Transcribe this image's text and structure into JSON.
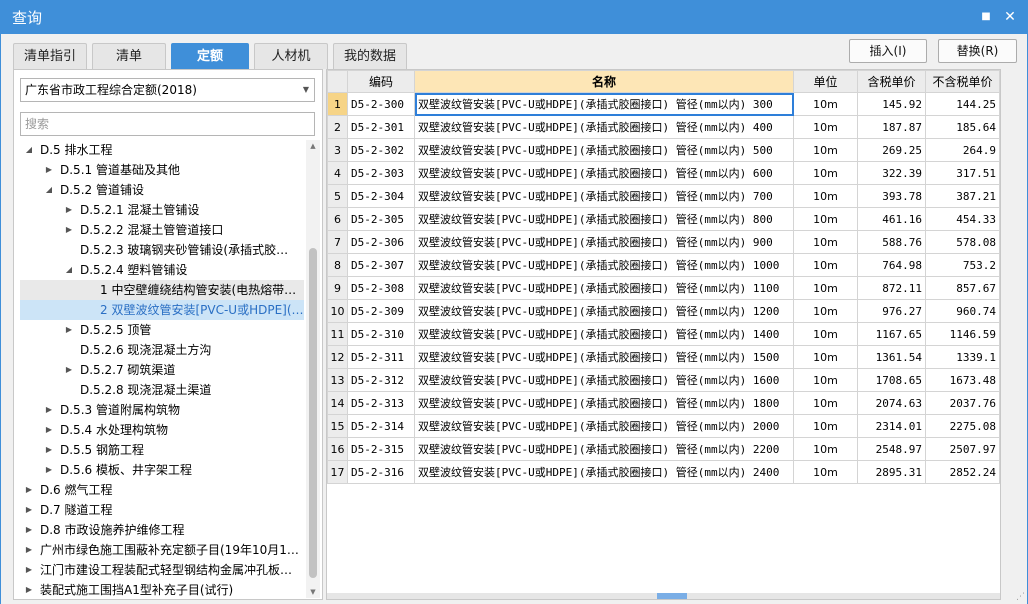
{
  "window": {
    "title": "查询",
    "maximize_icon": "■",
    "close_icon": "✕"
  },
  "tabs": [
    {
      "label": "清单指引",
      "active": false
    },
    {
      "label": "清单",
      "active": false
    },
    {
      "label": "定额",
      "active": true
    },
    {
      "label": "人材机",
      "active": false
    },
    {
      "label": "我的数据",
      "active": false
    }
  ],
  "actions": {
    "insert": "插入(I)",
    "replace": "替换(R)"
  },
  "library": {
    "selected": "广东省市政工程综合定额(2018)"
  },
  "search": {
    "placeholder": "搜索"
  },
  "tree": [
    {
      "level": 0,
      "expanded": true,
      "has_children": true,
      "label": "D.5 排水工程"
    },
    {
      "level": 1,
      "expanded": false,
      "has_children": true,
      "label": "D.5.1 管道基础及其他"
    },
    {
      "level": 1,
      "expanded": true,
      "has_children": true,
      "label": "D.5.2 管道铺设"
    },
    {
      "level": 2,
      "expanded": false,
      "has_children": true,
      "label": "D.5.2.1 混凝土管铺设"
    },
    {
      "level": 2,
      "expanded": false,
      "has_children": true,
      "label": "D.5.2.2 混凝土管管道接口"
    },
    {
      "level": 2,
      "expanded": false,
      "has_children": false,
      "label": "D.5.2.3 玻璃钢夹砂管铺设(承插式胶…"
    },
    {
      "level": 2,
      "expanded": true,
      "has_children": true,
      "label": "D.5.2.4 塑料管铺设"
    },
    {
      "level": 3,
      "expanded": false,
      "has_children": false,
      "label": "1 中空壁缠绕结构管安装(电热熔带…",
      "state": "hover"
    },
    {
      "level": 3,
      "expanded": false,
      "has_children": false,
      "label": "2 双壁波纹管安装[PVC-U或HDPE](…",
      "state": "selected"
    },
    {
      "level": 2,
      "expanded": false,
      "has_children": true,
      "label": "D.5.2.5 顶管"
    },
    {
      "level": 2,
      "expanded": false,
      "has_children": false,
      "label": "D.5.2.6 现浇混凝土方沟"
    },
    {
      "level": 2,
      "expanded": false,
      "has_children": true,
      "label": "D.5.2.7 砌筑渠道"
    },
    {
      "level": 2,
      "expanded": false,
      "has_children": false,
      "label": "D.5.2.8 现浇混凝土渠道"
    },
    {
      "level": 1,
      "expanded": false,
      "has_children": true,
      "label": "D.5.3 管道附属构筑物"
    },
    {
      "level": 1,
      "expanded": false,
      "has_children": true,
      "label": "D.5.4 水处理构筑物"
    },
    {
      "level": 1,
      "expanded": false,
      "has_children": true,
      "label": "D.5.5 钢筋工程"
    },
    {
      "level": 1,
      "expanded": false,
      "has_children": true,
      "label": "D.5.6 模板、井字架工程"
    },
    {
      "level": 0,
      "expanded": false,
      "has_children": true,
      "label": "D.6 燃气工程"
    },
    {
      "level": 0,
      "expanded": false,
      "has_children": true,
      "label": "D.7 隧道工程"
    },
    {
      "level": 0,
      "expanded": false,
      "has_children": true,
      "label": "D.8 市政设施养护维修工程"
    },
    {
      "level": 0,
      "expanded": false,
      "has_children": true,
      "label": "广州市绿色施工围蔽补充定额子目(19年10月1…"
    },
    {
      "level": 0,
      "expanded": false,
      "has_children": true,
      "label": "江门市建设工程装配式轻型钢结构金属冲孔板…"
    },
    {
      "level": 0,
      "expanded": false,
      "has_children": true,
      "label": "装配式施工围挡A1型补充子目(试行)"
    }
  ],
  "grid": {
    "columns": {
      "code": "编码",
      "name": "名称",
      "unit": "单位",
      "tax_price": "含税单价",
      "notax_price": "不含税单价"
    },
    "rows": [
      {
        "no": "1",
        "code": "D5-2-300",
        "name": "双壁波纹管安装[PVC-U或HDPE](承插式胶圈接口) 管径(mm以内) 300",
        "unit": "10m",
        "tax": "145.92",
        "notax": "144.25"
      },
      {
        "no": "2",
        "code": "D5-2-301",
        "name": "双壁波纹管安装[PVC-U或HDPE](承插式胶圈接口) 管径(mm以内) 400",
        "unit": "10m",
        "tax": "187.87",
        "notax": "185.64"
      },
      {
        "no": "3",
        "code": "D5-2-302",
        "name": "双壁波纹管安装[PVC-U或HDPE](承插式胶圈接口) 管径(mm以内) 500",
        "unit": "10m",
        "tax": "269.25",
        "notax": "264.9"
      },
      {
        "no": "4",
        "code": "D5-2-303",
        "name": "双壁波纹管安装[PVC-U或HDPE](承插式胶圈接口) 管径(mm以内) 600",
        "unit": "10m",
        "tax": "322.39",
        "notax": "317.51"
      },
      {
        "no": "5",
        "code": "D5-2-304",
        "name": "双壁波纹管安装[PVC-U或HDPE](承插式胶圈接口) 管径(mm以内) 700",
        "unit": "10m",
        "tax": "393.78",
        "notax": "387.21"
      },
      {
        "no": "6",
        "code": "D5-2-305",
        "name": "双壁波纹管安装[PVC-U或HDPE](承插式胶圈接口) 管径(mm以内) 800",
        "unit": "10m",
        "tax": "461.16",
        "notax": "454.33"
      },
      {
        "no": "7",
        "code": "D5-2-306",
        "name": "双壁波纹管安装[PVC-U或HDPE](承插式胶圈接口) 管径(mm以内) 900",
        "unit": "10m",
        "tax": "588.76",
        "notax": "578.08"
      },
      {
        "no": "8",
        "code": "D5-2-307",
        "name": "双壁波纹管安装[PVC-U或HDPE](承插式胶圈接口) 管径(mm以内) 1000",
        "unit": "10m",
        "tax": "764.98",
        "notax": "753.2"
      },
      {
        "no": "9",
        "code": "D5-2-308",
        "name": "双壁波纹管安装[PVC-U或HDPE](承插式胶圈接口) 管径(mm以内) 1100",
        "unit": "10m",
        "tax": "872.11",
        "notax": "857.67"
      },
      {
        "no": "10",
        "code": "D5-2-309",
        "name": "双壁波纹管安装[PVC-U或HDPE](承插式胶圈接口) 管径(mm以内) 1200",
        "unit": "10m",
        "tax": "976.27",
        "notax": "960.74"
      },
      {
        "no": "11",
        "code": "D5-2-310",
        "name": "双壁波纹管安装[PVC-U或HDPE](承插式胶圈接口) 管径(mm以内) 1400",
        "unit": "10m",
        "tax": "1167.65",
        "notax": "1146.59"
      },
      {
        "no": "12",
        "code": "D5-2-311",
        "name": "双壁波纹管安装[PVC-U或HDPE](承插式胶圈接口) 管径(mm以内) 1500",
        "unit": "10m",
        "tax": "1361.54",
        "notax": "1339.1"
      },
      {
        "no": "13",
        "code": "D5-2-312",
        "name": "双壁波纹管安装[PVC-U或HDPE](承插式胶圈接口) 管径(mm以内) 1600",
        "unit": "10m",
        "tax": "1708.65",
        "notax": "1673.48"
      },
      {
        "no": "14",
        "code": "D5-2-313",
        "name": "双壁波纹管安装[PVC-U或HDPE](承插式胶圈接口) 管径(mm以内) 1800",
        "unit": "10m",
        "tax": "2074.63",
        "notax": "2037.76"
      },
      {
        "no": "15",
        "code": "D5-2-314",
        "name": "双壁波纹管安装[PVC-U或HDPE](承插式胶圈接口) 管径(mm以内) 2000",
        "unit": "10m",
        "tax": "2314.01",
        "notax": "2275.08"
      },
      {
        "no": "16",
        "code": "D5-2-315",
        "name": "双壁波纹管安装[PVC-U或HDPE](承插式胶圈接口) 管径(mm以内) 2200",
        "unit": "10m",
        "tax": "2548.97",
        "notax": "2507.97"
      },
      {
        "no": "17",
        "code": "D5-2-316",
        "name": "双壁波纹管安装[PVC-U或HDPE](承插式胶圈接口) 管径(mm以内) 2400",
        "unit": "10m",
        "tax": "2895.31",
        "notax": "2852.24"
      }
    ]
  },
  "colors": {
    "accent": "#3f8fd9",
    "selected_row_bg": "#cce4f7",
    "name_header_bg": "#fde6b6"
  }
}
